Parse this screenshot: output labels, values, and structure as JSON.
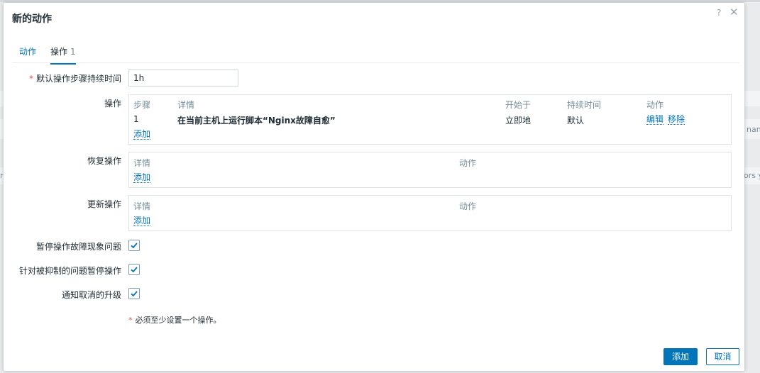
{
  "background": {
    "fragment_left": "rs",
    "fragment_right_top": "nan",
    "fragment_right_bottom": "ors y"
  },
  "dialog": {
    "title": "新的动作",
    "help_icon": "?",
    "close_icon": "✕"
  },
  "tabs": [
    {
      "label": "动作",
      "count": ""
    },
    {
      "label": "操作",
      "count": "1"
    }
  ],
  "default_duration": {
    "label": "默认操作步骤持续时间",
    "required_mark": "*",
    "value": "1h"
  },
  "operations": {
    "label": "操作",
    "headers": {
      "step": "步骤",
      "details": "详情",
      "start": "开始于",
      "duration": "持续时间",
      "action": "动作"
    },
    "rows": [
      {
        "step": "1",
        "details": "在当前主机上运行脚本“Nginx故障自愈”",
        "start": "立即地",
        "duration": "默认",
        "edit": "编辑",
        "remove": "移除"
      }
    ],
    "add": "添加"
  },
  "recovery_operations": {
    "label": "恢复操作",
    "headers": {
      "details": "详情",
      "action": "动作"
    },
    "add": "添加"
  },
  "update_operations": {
    "label": "更新操作",
    "headers": {
      "details": "详情",
      "action": "动作"
    },
    "add": "添加"
  },
  "checkboxes": [
    {
      "label": "暂停操作故障现象问题",
      "checked": true
    },
    {
      "label": "针对被抑制的问题暂停操作",
      "checked": true
    },
    {
      "label": "通知取消的升级",
      "checked": true
    }
  ],
  "note": {
    "required_mark": "*",
    "text": "必须至少设置一个操作。"
  },
  "buttons": {
    "add": "添加",
    "cancel": "取消"
  },
  "colors": {
    "accent": "#0275b8",
    "required": "#e45959"
  }
}
